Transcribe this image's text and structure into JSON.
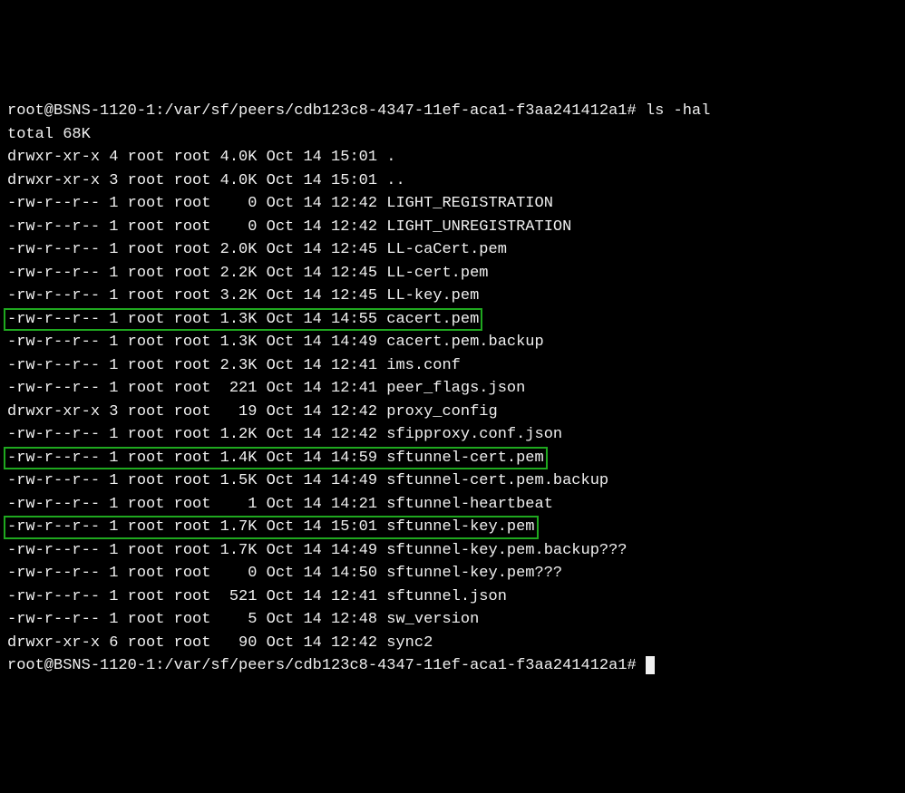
{
  "prompt_prefix": "root@BSNS-1120-1:/var/sf/peers/cdb123c8-4347-11ef-aca1-f3aa241412a1# ",
  "command": "ls -hal",
  "total_line": "total 68K",
  "listing": [
    {
      "perms": "drwxr-xr-x",
      "links": "4",
      "owner": "root",
      "group": "root",
      "size": "4.0K",
      "month": "Oct",
      "day": "14",
      "time": "15:01",
      "name": "."
    },
    {
      "perms": "drwxr-xr-x",
      "links": "3",
      "owner": "root",
      "group": "root",
      "size": "4.0K",
      "month": "Oct",
      "day": "14",
      "time": "15:01",
      "name": ".."
    },
    {
      "perms": "-rw-r--r--",
      "links": "1",
      "owner": "root",
      "group": "root",
      "size": "0",
      "month": "Oct",
      "day": "14",
      "time": "12:42",
      "name": "LIGHT_REGISTRATION"
    },
    {
      "perms": "-rw-r--r--",
      "links": "1",
      "owner": "root",
      "group": "root",
      "size": "0",
      "month": "Oct",
      "day": "14",
      "time": "12:42",
      "name": "LIGHT_UNREGISTRATION"
    },
    {
      "perms": "-rw-r--r--",
      "links": "1",
      "owner": "root",
      "group": "root",
      "size": "2.0K",
      "month": "Oct",
      "day": "14",
      "time": "12:45",
      "name": "LL-caCert.pem"
    },
    {
      "perms": "-rw-r--r--",
      "links": "1",
      "owner": "root",
      "group": "root",
      "size": "2.2K",
      "month": "Oct",
      "day": "14",
      "time": "12:45",
      "name": "LL-cert.pem"
    },
    {
      "perms": "-rw-r--r--",
      "links": "1",
      "owner": "root",
      "group": "root",
      "size": "3.2K",
      "month": "Oct",
      "day": "14",
      "time": "12:45",
      "name": "LL-key.pem"
    },
    {
      "perms": "-rw-r--r--",
      "links": "1",
      "owner": "root",
      "group": "root",
      "size": "1.3K",
      "month": "Oct",
      "day": "14",
      "time": "14:55",
      "name": "cacert.pem",
      "highlight": true
    },
    {
      "perms": "-rw-r--r--",
      "links": "1",
      "owner": "root",
      "group": "root",
      "size": "1.3K",
      "month": "Oct",
      "day": "14",
      "time": "14:49",
      "name": "cacert.pem.backup"
    },
    {
      "perms": "-rw-r--r--",
      "links": "1",
      "owner": "root",
      "group": "root",
      "size": "2.3K",
      "month": "Oct",
      "day": "14",
      "time": "12:41",
      "name": "ims.conf"
    },
    {
      "perms": "-rw-r--r--",
      "links": "1",
      "owner": "root",
      "group": "root",
      "size": "221",
      "month": "Oct",
      "day": "14",
      "time": "12:41",
      "name": "peer_flags.json"
    },
    {
      "perms": "drwxr-xr-x",
      "links": "3",
      "owner": "root",
      "group": "root",
      "size": "19",
      "month": "Oct",
      "day": "14",
      "time": "12:42",
      "name": "proxy_config"
    },
    {
      "perms": "-rw-r--r--",
      "links": "1",
      "owner": "root",
      "group": "root",
      "size": "1.2K",
      "month": "Oct",
      "day": "14",
      "time": "12:42",
      "name": "sfipproxy.conf.json"
    },
    {
      "perms": "-rw-r--r--",
      "links": "1",
      "owner": "root",
      "group": "root",
      "size": "1.4K",
      "month": "Oct",
      "day": "14",
      "time": "14:59",
      "name": "sftunnel-cert.pem",
      "highlight": true
    },
    {
      "perms": "-rw-r--r--",
      "links": "1",
      "owner": "root",
      "group": "root",
      "size": "1.5K",
      "month": "Oct",
      "day": "14",
      "time": "14:49",
      "name": "sftunnel-cert.pem.backup"
    },
    {
      "perms": "-rw-r--r--",
      "links": "1",
      "owner": "root",
      "group": "root",
      "size": "1",
      "month": "Oct",
      "day": "14",
      "time": "14:21",
      "name": "sftunnel-heartbeat"
    },
    {
      "perms": "-rw-r--r--",
      "links": "1",
      "owner": "root",
      "group": "root",
      "size": "1.7K",
      "month": "Oct",
      "day": "14",
      "time": "15:01",
      "name": "sftunnel-key.pem",
      "highlight": true
    },
    {
      "perms": "-rw-r--r--",
      "links": "1",
      "owner": "root",
      "group": "root",
      "size": "1.7K",
      "month": "Oct",
      "day": "14",
      "time": "14:49",
      "name": "sftunnel-key.pem.backup???"
    },
    {
      "perms": "-rw-r--r--",
      "links": "1",
      "owner": "root",
      "group": "root",
      "size": "0",
      "month": "Oct",
      "day": "14",
      "time": "14:50",
      "name": "sftunnel-key.pem???"
    },
    {
      "perms": "-rw-r--r--",
      "links": "1",
      "owner": "root",
      "group": "root",
      "size": "521",
      "month": "Oct",
      "day": "14",
      "time": "12:41",
      "name": "sftunnel.json"
    },
    {
      "perms": "-rw-r--r--",
      "links": "1",
      "owner": "root",
      "group": "root",
      "size": "5",
      "month": "Oct",
      "day": "14",
      "time": "12:48",
      "name": "sw_version"
    },
    {
      "perms": "drwxr-xr-x",
      "links": "6",
      "owner": "root",
      "group": "root",
      "size": "90",
      "month": "Oct",
      "day": "14",
      "time": "12:42",
      "name": "sync2"
    }
  ],
  "prompt_trailing": "root@BSNS-1120-1:/var/sf/peers/cdb123c8-4347-11ef-aca1-f3aa241412a1# "
}
